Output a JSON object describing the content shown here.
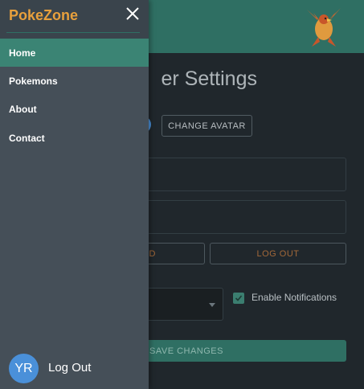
{
  "settings": {
    "title": "er Settings",
    "change_avatar_label": "CHANGE AVATAR",
    "reset_label": "D",
    "logout_label": "LOG OUT",
    "notifications_label": "Enable Notifications",
    "notifications_enabled": true,
    "save_label": "SAVE CHANGES"
  },
  "drawer": {
    "logo": "PokeZone",
    "nav": [
      {
        "label": "Home",
        "active": true
      },
      {
        "label": "Pokemons",
        "active": false
      },
      {
        "label": "About",
        "active": false
      },
      {
        "label": "Contact",
        "active": false
      }
    ],
    "user_initials": "YR",
    "logout_label": "Log Out"
  },
  "colors": {
    "accent": "#2f6f63",
    "active_nav": "#3b8474",
    "logo": "#e8a03c",
    "avatar": "#4a90d9",
    "drawer_bg": "#454f58",
    "page_bg": "#20272c"
  },
  "icons": {
    "close": "close-icon",
    "bird": "bird-logo-icon",
    "caret": "chevron-down-icon",
    "check": "check-icon"
  }
}
